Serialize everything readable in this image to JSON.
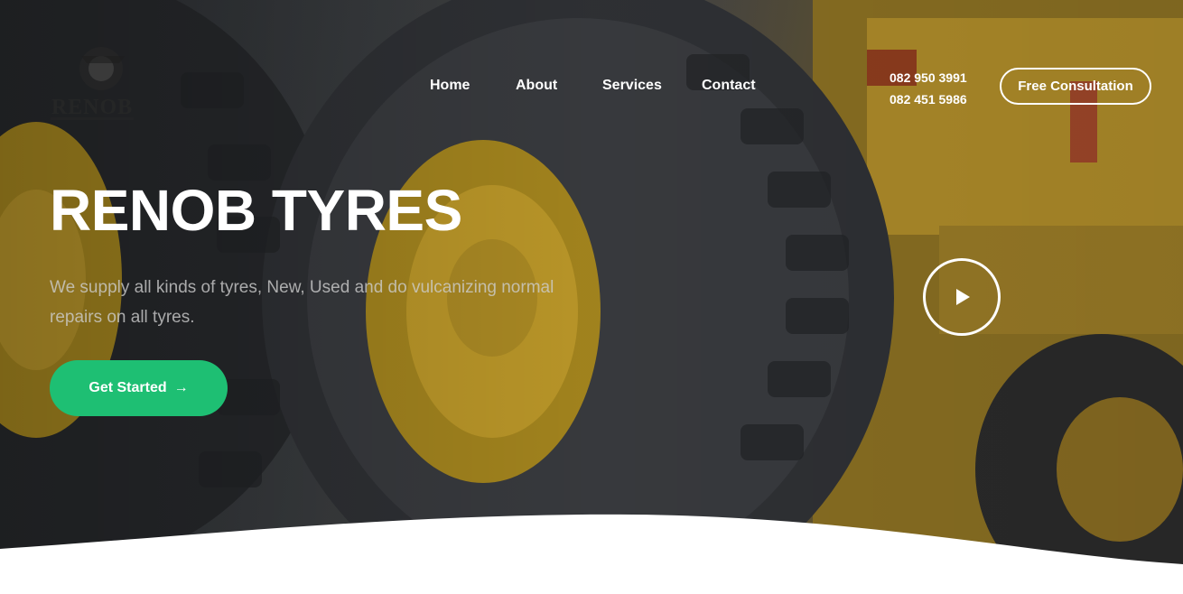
{
  "brand": {
    "logo_text": "RENOB",
    "logo_icon": "tyre-logo-icon"
  },
  "nav": {
    "items": [
      "Home",
      "About",
      "Services",
      "Contact"
    ]
  },
  "contact": {
    "phones": [
      "082 950 3991",
      "082 451 5986"
    ]
  },
  "header": {
    "cta_label": "Free Consultation"
  },
  "hero": {
    "title": "RENOB TYRES",
    "subtitle": "We supply all kinds of tyres, New, Used and do vulcanizing normal repairs on all tyres.",
    "cta_label": "Get Started",
    "cta_icon": "arrow-right-icon",
    "play_icon": "play-icon"
  },
  "colors": {
    "accent": "#1ebf73",
    "text_light": "#ffffff",
    "wheel_yellow": "#c9a227"
  }
}
